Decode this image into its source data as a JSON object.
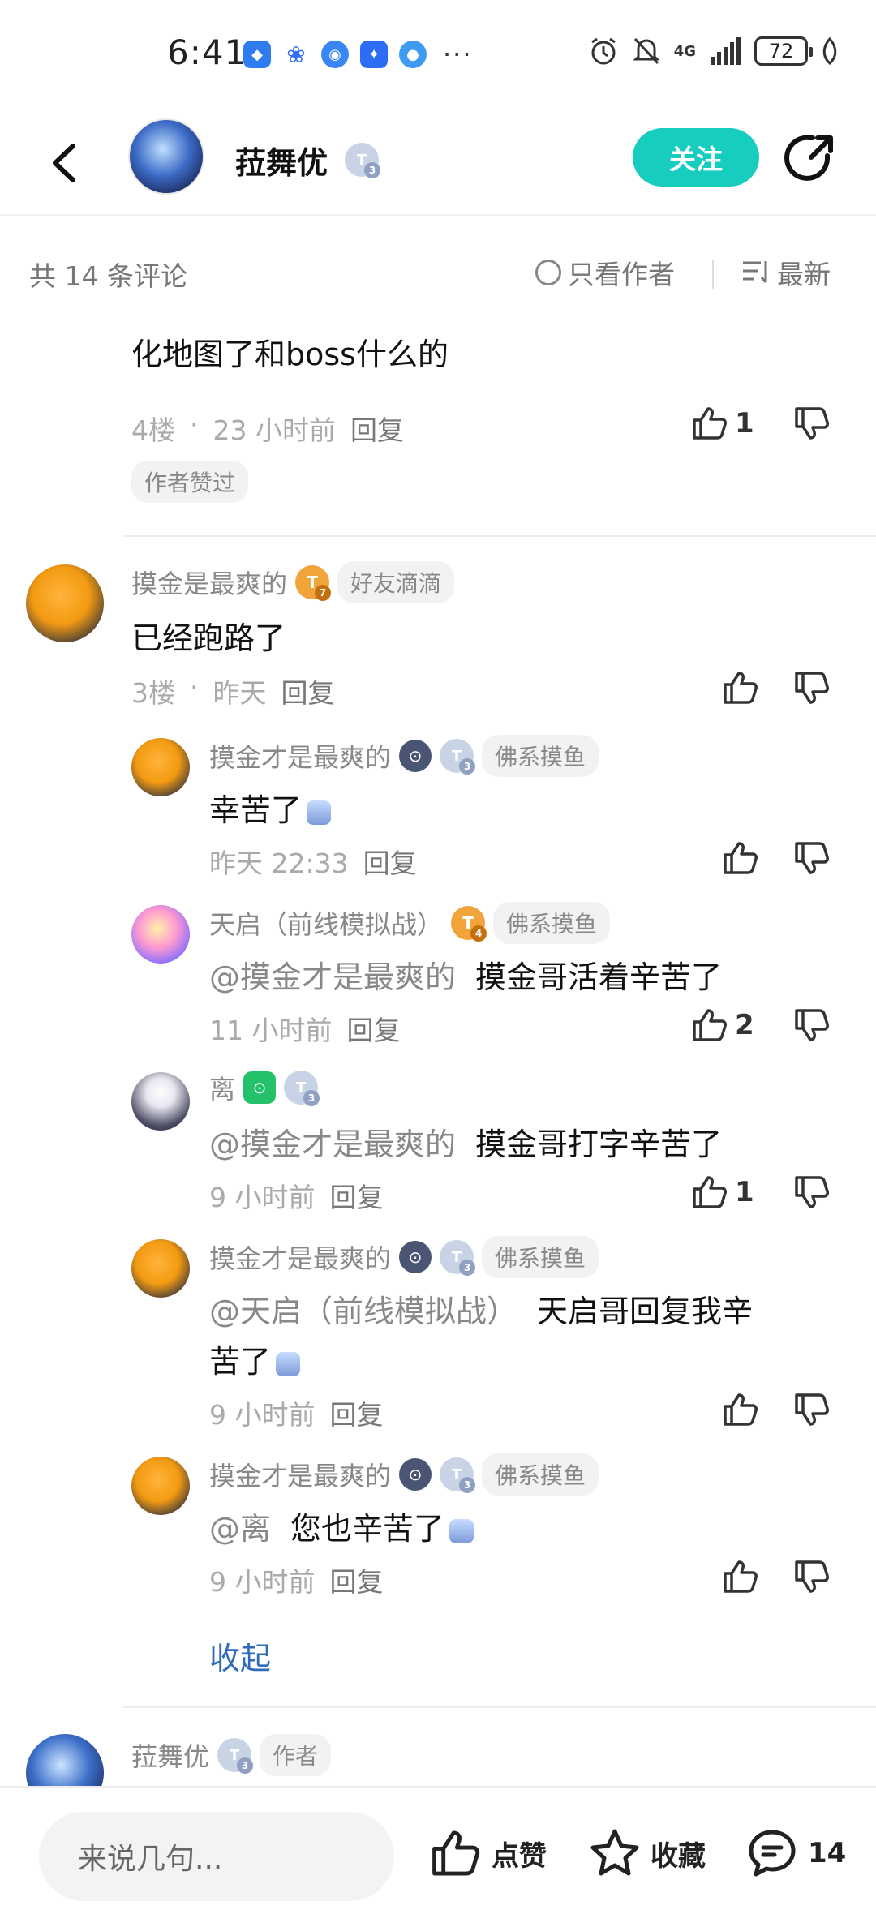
{
  "status_bar": {
    "time": "6:41",
    "network": "4G",
    "battery": "72"
  },
  "header": {
    "name": "菈舞优",
    "level": "3",
    "follow_label": "关注"
  },
  "sort": {
    "count_label": "共 14 条评论",
    "only_author_label": "只看作者",
    "latest_label": "最新"
  },
  "comments": {
    "c4": {
      "text": "化地图了和boss什么的",
      "floor": "4楼",
      "time": "23 小时前",
      "reply_label": "回复",
      "likes": "1",
      "liked_by_author": "作者赞过"
    },
    "c3": {
      "name": "摸金是最爽的",
      "level": "7",
      "tag": "好友滴滴",
      "text": "已经跑路了",
      "floor": "3楼",
      "time": "昨天",
      "reply_label": "回复",
      "replies": [
        {
          "name": "摸金才是最爽的",
          "level": "3",
          "tag": "佛系摸鱼",
          "mention": "",
          "text": "幸苦了",
          "time": "昨天 22:33",
          "reply_label": "回复",
          "likes": ""
        },
        {
          "name": "天启（前线模拟战）",
          "level": "4",
          "tag": "佛系摸鱼",
          "mention": "@摸金才是最爽的",
          "text": "摸金哥活着辛苦了",
          "time": "11 小时前",
          "reply_label": "回复",
          "likes": "2"
        },
        {
          "name": "离",
          "level": "3",
          "tag": "",
          "mention": "@摸金才是最爽的",
          "text": "摸金哥打字辛苦了",
          "time": "9 小时前",
          "reply_label": "回复",
          "likes": "1"
        },
        {
          "name": "摸金才是最爽的",
          "level": "3",
          "tag": "佛系摸鱼",
          "mention": "@天启（前线模拟战）",
          "text": "天启哥回复我辛",
          "text2": "苦了",
          "time": "9 小时前",
          "reply_label": "回复",
          "likes": ""
        },
        {
          "name": "摸金才是最爽的",
          "level": "3",
          "tag": "佛系摸鱼",
          "mention": "@离",
          "text": "您也辛苦了",
          "time": "9 小时前",
          "reply_label": "回复",
          "likes": ""
        }
      ],
      "collapse_label": "收起"
    },
    "c2": {
      "name": "菈舞优",
      "level": "3",
      "author_tag": "作者"
    }
  },
  "bottom_bar": {
    "input_placeholder": "来说几句...",
    "like_label": "点赞",
    "favorite_label": "收藏",
    "comment_count": "14"
  },
  "colors": {
    "accent": "#16cdc0",
    "link": "#2e6bb8"
  }
}
